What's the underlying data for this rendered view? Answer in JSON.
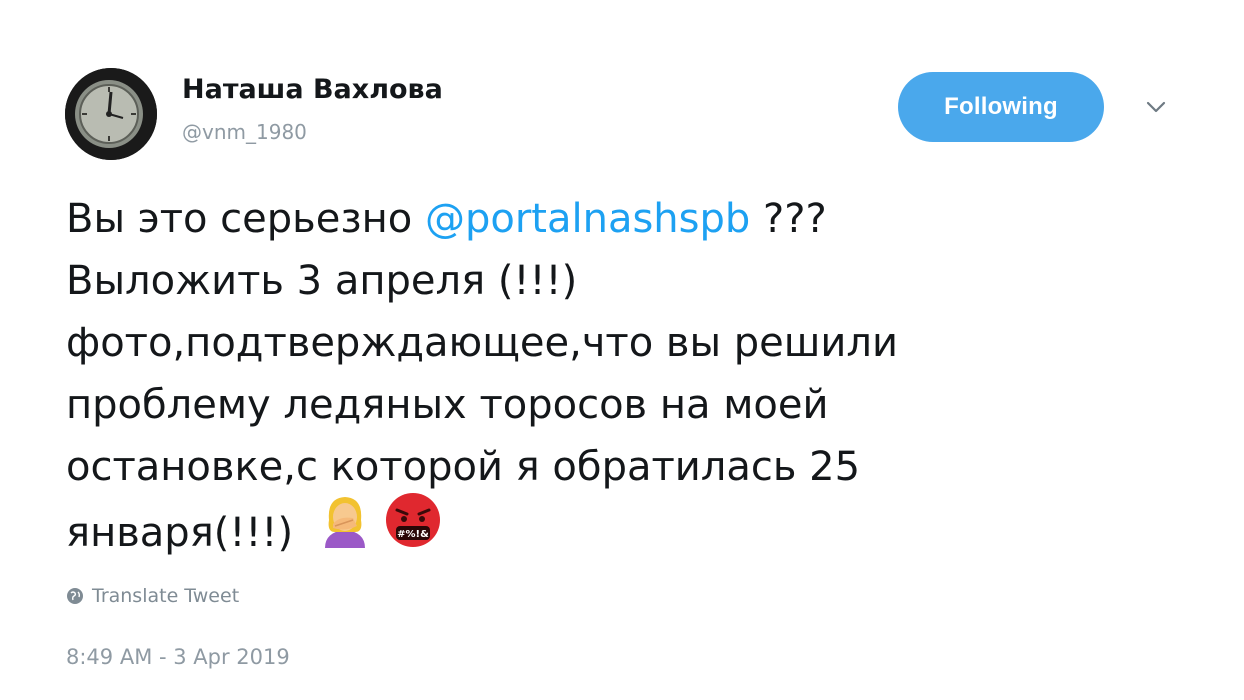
{
  "user": {
    "display_name": "Наташа Вахлова",
    "handle": "@vnm_1980",
    "avatar_icon": "clock-avatar-icon"
  },
  "header": {
    "follow_label": "Following",
    "follow_color": "#4aa8ec",
    "menu_icon": "chevron-down-icon"
  },
  "tweet": {
    "line1_pre": "Вы это серьезно ",
    "mention": "@portalnashspb",
    "line1_post": " ???",
    "line2": "Выложить 3 апреля (!!!)",
    "line3": "фото,подтверждающее,что вы решили",
    "line4": "проблему ледяных торосов на моей",
    "line5": "остановке,с которой я обратилась 25",
    "line6": "января(!!!)",
    "emoji_1": "woman-facepalming-emoji",
    "emoji_2": "face-with-symbols-emoji",
    "emoji_2_symbols": "#%!&",
    "mention_color": "#1da1f2"
  },
  "translate": {
    "label": "Translate Tweet",
    "icon": "globe-icon"
  },
  "meta": {
    "timestamp": "8:49 AM - 3 Apr 2019"
  }
}
